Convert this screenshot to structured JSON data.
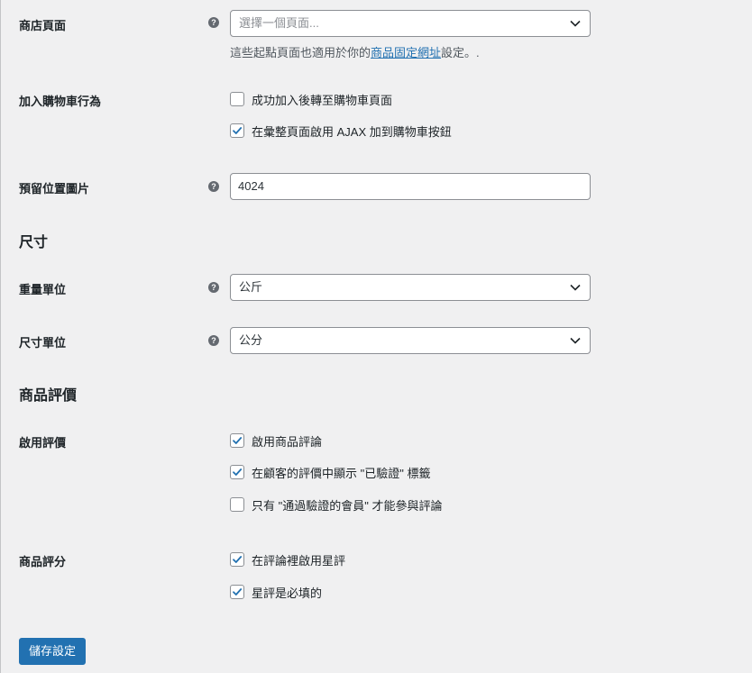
{
  "shop_page": {
    "label": "商店頁面",
    "placeholder": "選擇一個頁面...",
    "desc_prefix": "這些起點頁面也適用於你的",
    "desc_link": "商品固定網址",
    "desc_suffix": "設定。."
  },
  "add_to_cart": {
    "label": "加入購物車行為",
    "options": [
      {
        "label": "成功加入後轉至購物車頁面",
        "checked": false
      },
      {
        "label": "在彙整頁面啟用 AJAX 加到購物車按鈕",
        "checked": true
      }
    ]
  },
  "placeholder_image": {
    "label": "預留位置圖片",
    "value": "4024"
  },
  "dimensions_section": {
    "title": "尺寸"
  },
  "weight_unit": {
    "label": "重量單位",
    "value": "公斤"
  },
  "dimension_unit": {
    "label": "尺寸單位",
    "value": "公分"
  },
  "reviews_section": {
    "title": "商品評價"
  },
  "enable_reviews": {
    "label": "啟用評價",
    "options": [
      {
        "label": "啟用商品評論",
        "checked": true
      },
      {
        "label": "在顧客的評價中顯示 \"已驗證\" 標籤",
        "checked": true
      },
      {
        "label": "只有 \"通過驗證的會員\" 才能參與評論",
        "checked": false
      }
    ]
  },
  "product_ratings": {
    "label": "商品評分",
    "options": [
      {
        "label": "在評論裡啟用星評",
        "checked": true
      },
      {
        "label": "星評是必填的",
        "checked": true
      }
    ]
  },
  "save_button": {
    "label": "儲存設定"
  },
  "help_icon": "?",
  "colors": {
    "accent": "#2271b1",
    "background": "#f0f0f1"
  }
}
